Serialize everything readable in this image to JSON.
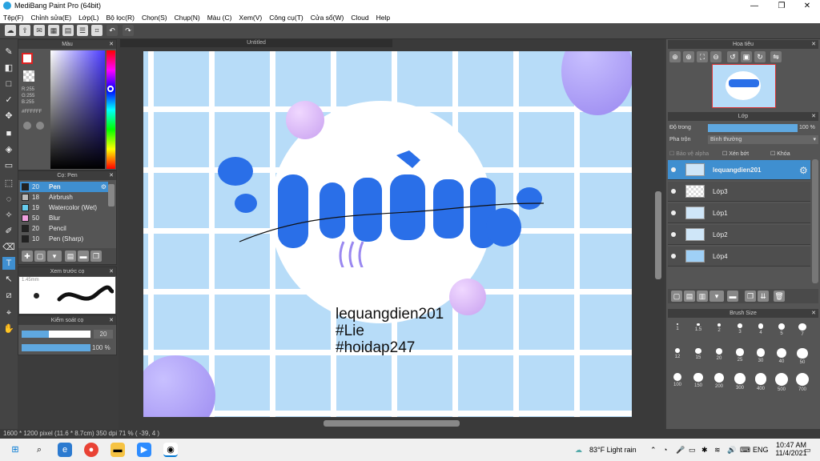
{
  "window": {
    "title": "MediBang Paint Pro (64bit)"
  },
  "menu": [
    "Tệp(F)",
    "Chỉnh sửa(E)",
    "Lớp(L)",
    "Bộ lọc(R)",
    "Chọn(S)",
    "Chụp(N)",
    "Màu (C)",
    "Xem(V)",
    "Công cụ(T)",
    "Cửa sổ(W)",
    "Cloud",
    "Help"
  ],
  "color_panel": {
    "title": "Màu",
    "r": "R:255",
    "g": "G:255",
    "b": "B:255",
    "hex": "#FFFFFF"
  },
  "brush_panel": {
    "title": "Cọ: Pen",
    "items": [
      {
        "size": "20",
        "name": "Pen",
        "color": "#222222"
      },
      {
        "size": "18",
        "name": "Airbrush",
        "color": "#bbbbbb"
      },
      {
        "size": "19",
        "name": "Watercolor (Wet)",
        "color": "#66ccee"
      },
      {
        "size": "50",
        "name": "Blur",
        "color": "#f0a0e0"
      },
      {
        "size": "20",
        "name": "Pencil",
        "color": "#222222"
      },
      {
        "size": "10",
        "name": "Pen (Sharp)",
        "color": "#222222"
      }
    ]
  },
  "preview_panel": {
    "title": "Xem trước cọ",
    "size": "1.45mm"
  },
  "control_panel": {
    "title": "Kiểm soát cọ",
    "size": "20",
    "opacity": "100 %",
    "size_level": 0.4,
    "opacity_level": 1.0
  },
  "document": {
    "tab": "Untitled",
    "text1": "lequangdien201",
    "text2": "#Lie",
    "text3": "#hoidap247"
  },
  "navigator": {
    "title": "Hoa tiêu"
  },
  "layers": {
    "title": "Lớp",
    "opacity_label": "Độ trong",
    "opacity_value": "100 %",
    "blend_label": "Pha trộn",
    "blend_value": "Bình thường",
    "protect": "Bảo vệ alpha",
    "clip": "Xén bớt",
    "lock": "Khóa",
    "items": [
      "lequangdien201",
      "Lớp3",
      "Lớp1",
      "Lớp2",
      "Lớp4"
    ]
  },
  "brush_size": {
    "title": "Brush Size",
    "values": [
      "1",
      "1.5",
      "2",
      "3",
      "4",
      "5",
      "7",
      "12",
      "15",
      "20",
      "25",
      "30",
      "40",
      "50",
      "100",
      "150",
      "200",
      "300",
      "400",
      "500",
      "700"
    ]
  },
  "status": "1600 * 1200 pixel  (11.6 * 8.7cm)  350 dpi  71 %  ( -39, 4 )",
  "taskbar": {
    "weather": "83°F  Light rain",
    "lang": "ENG",
    "time": "10:47 AM",
    "date": "11/4/2021"
  }
}
